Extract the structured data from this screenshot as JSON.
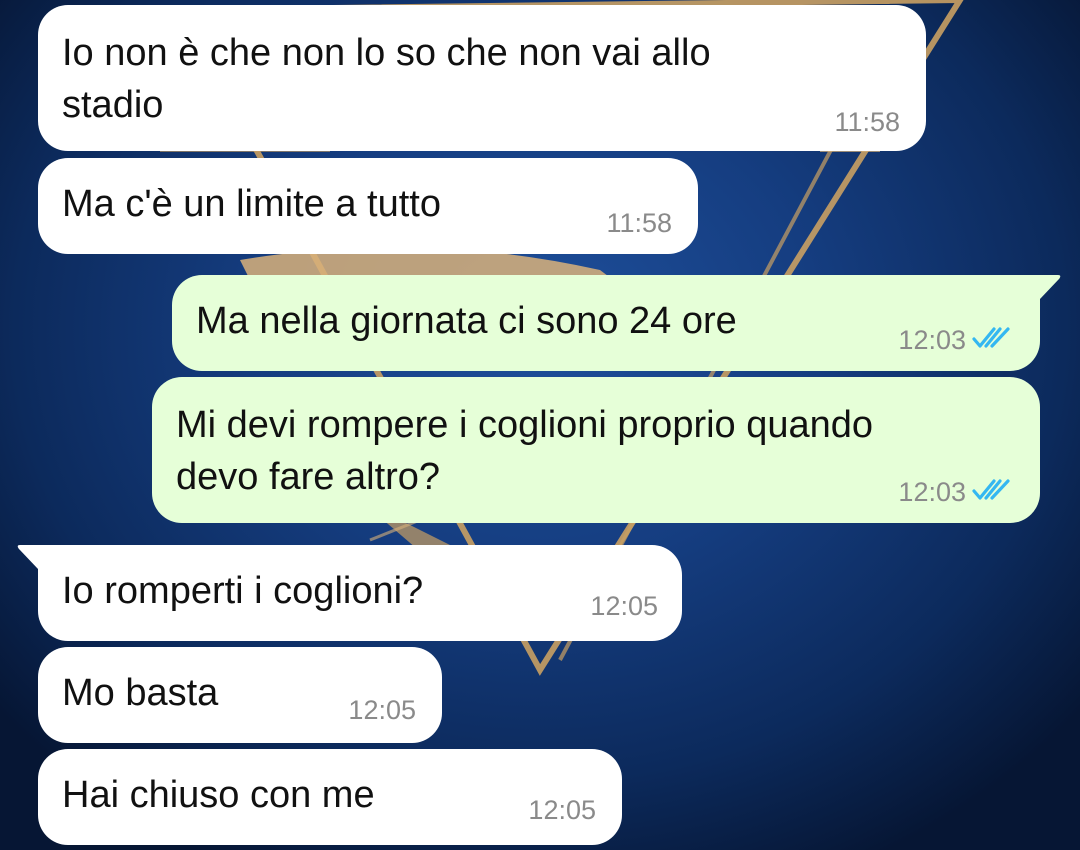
{
  "chat": {
    "messages": [
      {
        "direction": "in",
        "text": "Io non è che non lo so che non vai allo\nstadio",
        "time": "11:58"
      },
      {
        "direction": "in",
        "text": "Ma c'è un limite a tutto",
        "time": "11:58"
      },
      {
        "direction": "out",
        "text": "Ma nella giornata ci sono 24 ore",
        "time": "12:03",
        "status": "read-double-check"
      },
      {
        "direction": "out",
        "text": "Mi devi rompere i coglioni proprio quando\ndevo fare altro?",
        "time": "12:03",
        "status": "read-double-check"
      },
      {
        "direction": "in",
        "text": "Io romperti i coglioni?",
        "time": "12:05"
      },
      {
        "direction": "in",
        "text": "Mo basta",
        "time": "12:05"
      },
      {
        "direction": "in",
        "text": "Hai chiuso con me",
        "time": "12:05"
      }
    ]
  },
  "colors": {
    "incoming_bubble": "#ffffff",
    "outgoing_bubble": "#e6ffd8",
    "read_ticks": "#34b7f1",
    "wallpaper_blue": "#153d80",
    "wallpaper_emblem_gold": "#c9a063"
  }
}
